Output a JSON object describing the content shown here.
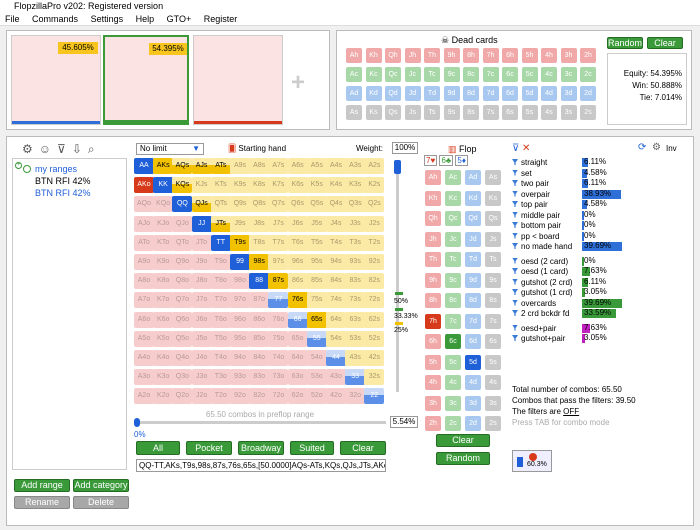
{
  "window": {
    "title": "FlopzillaPro v202: Registered version"
  },
  "menu": [
    "File",
    "Commands",
    "Settings",
    "Help",
    "GTO+",
    "Register"
  ],
  "top": {
    "range1_equity": "45.605%",
    "range2_equity": "54.395%",
    "dead_cards_label": "Dead cards",
    "random_label": "Random",
    "clear_label": "Clear",
    "equity": "Equity: 54.395%",
    "win": "Win: 50.888%",
    "tie": "Tie: 7.014%",
    "dead_rows": [
      [
        "Ah",
        "Kh",
        "Qh",
        "Jh",
        "Th",
        "9h",
        "8h",
        "7h",
        "6h",
        "5h",
        "4h",
        "3h",
        "2h"
      ],
      [
        "Ac",
        "Kc",
        "Qc",
        "Jc",
        "Tc",
        "9c",
        "8c",
        "7c",
        "6c",
        "5c",
        "4c",
        "3c",
        "2c"
      ],
      [
        "Ad",
        "Kd",
        "Qd",
        "Jd",
        "Td",
        "9d",
        "8d",
        "7d",
        "6d",
        "5d",
        "4d",
        "3d",
        "2d"
      ],
      [
        "As",
        "Ks",
        "Qs",
        "Js",
        "Ts",
        "9s",
        "8s",
        "7s",
        "6s",
        "5s",
        "4s",
        "3s",
        "2s"
      ]
    ]
  },
  "sidebar": {
    "tree": [
      "my ranges",
      "BTN RFI 42%",
      "BTN RFI 42%"
    ],
    "add_range": "Add range",
    "add_category": "Add category",
    "rename": "Rename",
    "delete": "Delete"
  },
  "range": {
    "limit": "No limit",
    "starting_hand": "Starting hand",
    "weight_label": "Weight:",
    "weight_value": "100%",
    "combos_text": "65.50 combos in preflop range",
    "slider_min": "0%",
    "slider_value": "5.54%",
    "w50": "50%",
    "w33": "33.33%",
    "w25": "25%",
    "buttons": [
      "All",
      "Pocket",
      "Broadway",
      "Suited",
      "Clear"
    ],
    "range_string": "QQ-TT,AKs,T9s,98s,87s,76s,65s,[50.0000]AQs-ATs,KQs,QJs,JTs,AKo"
  },
  "grid": [
    [
      "AA",
      "AKs",
      "AQs",
      "AJs",
      "ATs",
      "A9s",
      "A8s",
      "A7s",
      "A6s",
      "A5s",
      "A4s",
      "A3s",
      "A2s"
    ],
    [
      "AKo",
      "KK",
      "KQs",
      "KJs",
      "KTs",
      "K9s",
      "K8s",
      "K7s",
      "K6s",
      "K5s",
      "K4s",
      "K3s",
      "K2s"
    ],
    [
      "AQo",
      "KQo",
      "QQ",
      "QJs",
      "QTs",
      "Q9s",
      "Q8s",
      "Q7s",
      "Q6s",
      "Q5s",
      "Q4s",
      "Q3s",
      "Q2s"
    ],
    [
      "AJo",
      "KJo",
      "QJo",
      "JJ",
      "JTs",
      "J9s",
      "J8s",
      "J7s",
      "J6s",
      "J5s",
      "J4s",
      "J3s",
      "J2s"
    ],
    [
      "ATo",
      "KTo",
      "QTo",
      "JTo",
      "TT",
      "T9s",
      "T8s",
      "T7s",
      "T6s",
      "T5s",
      "T4s",
      "T3s",
      "T2s"
    ],
    [
      "A9o",
      "K9o",
      "Q9o",
      "J9o",
      "T9o",
      "99",
      "98s",
      "97s",
      "96s",
      "95s",
      "94s",
      "93s",
      "92s"
    ],
    [
      "A8o",
      "K8o",
      "Q8o",
      "J8o",
      "T8o",
      "98o",
      "88",
      "87s",
      "86s",
      "85s",
      "84s",
      "83s",
      "82s"
    ],
    [
      "A7o",
      "K7o",
      "Q7o",
      "J7o",
      "T7o",
      "97o",
      "87o",
      "77",
      "76s",
      "75s",
      "74s",
      "73s",
      "72s"
    ],
    [
      "A6o",
      "K6o",
      "Q6o",
      "J6o",
      "T6o",
      "96o",
      "86o",
      "76o",
      "66",
      "65s",
      "64s",
      "63s",
      "62s"
    ],
    [
      "A5o",
      "K5o",
      "Q5o",
      "J5o",
      "T5o",
      "95o",
      "85o",
      "75o",
      "65o",
      "55",
      "54s",
      "53s",
      "52s"
    ],
    [
      "A4o",
      "K4o",
      "Q4o",
      "J4o",
      "T4o",
      "94o",
      "84o",
      "74o",
      "64o",
      "54o",
      "44",
      "43s",
      "42s"
    ],
    [
      "A3o",
      "K3o",
      "Q3o",
      "J3o",
      "T3o",
      "93o",
      "83o",
      "73o",
      "63o",
      "53o",
      "43o",
      "33",
      "32s"
    ],
    [
      "A2o",
      "K2o",
      "Q2o",
      "J2o",
      "T2o",
      "92o",
      "82o",
      "72o",
      "62o",
      "52o",
      "42o",
      "32o",
      "22"
    ]
  ],
  "selected": {
    "full_blue": [
      "KK",
      "QQ",
      "JJ",
      "TT",
      "99",
      "88"
    ],
    "half_blue": [
      "77",
      "66",
      "55",
      "44",
      "33",
      "22"
    ],
    "gold": [
      "AKs",
      "T9s",
      "98s",
      "87s",
      "76s",
      "65s"
    ],
    "half_gold": [
      "AQs",
      "AJs",
      "ATs",
      "KQs",
      "QJs",
      "JTs"
    ],
    "aa": "AA",
    "red": "AKo"
  },
  "flop": {
    "label": "Flop",
    "suits": [
      "7♥",
      "6♣",
      "5♦"
    ],
    "rows": [
      [
        "Ah",
        "Ac",
        "Ad",
        "As"
      ],
      [
        "Kh",
        "Kc",
        "Kd",
        "Ks"
      ],
      [
        "Qh",
        "Qc",
        "Qd",
        "Qs"
      ],
      [
        "Jh",
        "Jc",
        "Jd",
        "Js"
      ],
      [
        "Th",
        "Tc",
        "Td",
        "Ts"
      ],
      [
        "9h",
        "9c",
        "9d",
        "9s"
      ],
      [
        "8h",
        "8c",
        "8d",
        "8s"
      ],
      [
        "7h",
        "7c",
        "7d",
        "7s"
      ],
      [
        "6h",
        "6c",
        "6d",
        "6s"
      ],
      [
        "5h",
        "5c",
        "5d",
        "5s"
      ],
      [
        "4h",
        "4c",
        "4d",
        "4s"
      ],
      [
        "3h",
        "3c",
        "3d",
        "3s"
      ],
      [
        "2h",
        "2c",
        "2d",
        "2s"
      ]
    ],
    "clear": "Clear",
    "random": "Random"
  },
  "stats": {
    "inv_label": "Inv",
    "rows": [
      {
        "label": "straight",
        "pct": "6.11%",
        "val": 6.11
      },
      {
        "label": "set",
        "pct": "4.58%",
        "val": 4.58
      },
      {
        "label": "two pair",
        "pct": "6.11%",
        "val": 6.11
      },
      {
        "label": "overpair",
        "pct": "38.93%",
        "val": 38.93
      },
      {
        "label": "top pair",
        "pct": "4.58%",
        "val": 4.58
      },
      {
        "label": "middle pair",
        "pct": "0%",
        "val": 0
      },
      {
        "label": "bottom pair",
        "pct": "0%",
        "val": 0
      },
      {
        "label": "pp < board",
        "pct": "0%",
        "val": 0
      },
      {
        "label": "no made hand",
        "pct": "39.69%",
        "val": 39.69
      }
    ],
    "draw_rows": [
      {
        "label": "oesd (2 card)",
        "pct": "0%",
        "val": 0
      },
      {
        "label": "oesd (1 card)",
        "pct": "7.63%",
        "val": 7.63
      },
      {
        "label": "gutshot (2 crd)",
        "pct": "6.11%",
        "val": 6.11
      },
      {
        "label": "gutshot (1 crd)",
        "pct": "3.05%",
        "val": 3.05
      },
      {
        "label": "overcards",
        "pct": "39.69%",
        "val": 39.69
      },
      {
        "label": "2 crd bckdr fd",
        "pct": "33.59%",
        "val": 33.59
      }
    ],
    "combo_rows": [
      {
        "label": "oesd+pair",
        "pct": "7.63%",
        "val": 7.63
      },
      {
        "label": "gutshot+pair",
        "pct": "3.05%",
        "val": 3.05
      }
    ],
    "total": "Total number of combos: 65.50",
    "pass": "Combos that pass the filters: 39.50",
    "filters_label": "The filters are",
    "filters_state": "OFF",
    "tab_hint": "Press TAB for combo mode",
    "summary_pct": "60.3%"
  },
  "colors": {
    "blue": "#1f5fd8",
    "gold": "#f2c200",
    "pink": "#f4c8c8",
    "yellow_light": "#fbeeb0",
    "green": "#3a9a3a",
    "red": "#d63a1a"
  }
}
